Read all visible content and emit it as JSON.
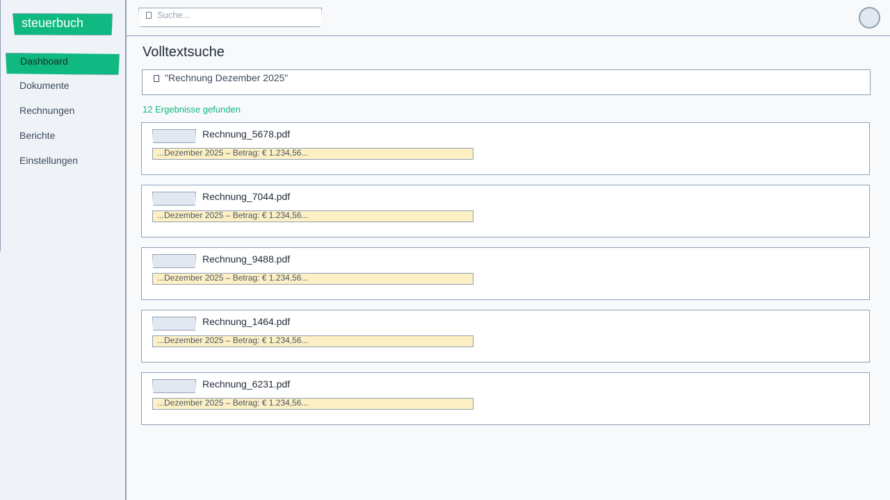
{
  "app": {
    "logo_text": "steuerbuch"
  },
  "sidebar": {
    "items": [
      {
        "label": "Dashboard",
        "active": true
      },
      {
        "label": "Dokumente"
      },
      {
        "label": "Rechnungen"
      },
      {
        "label": "Berichte"
      },
      {
        "label": "Einstellungen"
      }
    ]
  },
  "topbar": {
    "search_placeholder": "Suche...",
    "search_icon": "search-icon",
    "avatar_icon": "avatar"
  },
  "main": {
    "title": "Volltextsuche",
    "query": "\"Rechnung Dezember 2025\"",
    "result_count": "12 Ergebnisse gefunden",
    "results": [
      {
        "filename": "Rechnung_5678.pdf",
        "snippet": "...Dezember 2025 – Betrag: € 1.234,56..."
      },
      {
        "filename": "Rechnung_7044.pdf",
        "snippet": "...Dezember 2025 – Betrag: € 1.234,56..."
      },
      {
        "filename": "Rechnung_9488.pdf",
        "snippet": "...Dezember 2025 – Betrag: € 1.234,56..."
      },
      {
        "filename": "Rechnung_1464.pdf",
        "snippet": "...Dezember 2025 – Betrag: € 1.234,56..."
      },
      {
        "filename": "Rechnung_6231.pdf",
        "snippet": "...Dezember 2025 – Betrag: € 1.234,56..."
      }
    ]
  },
  "colors": {
    "accent": "#10b981",
    "highlight": "#fdf0c4",
    "border": "#8ea0b6"
  }
}
